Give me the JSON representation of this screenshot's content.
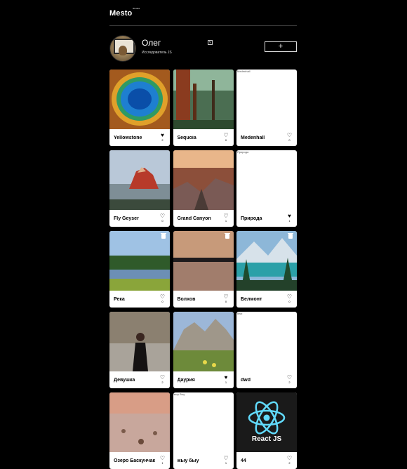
{
  "header": {
    "logo": "Mesto",
    "logo_sup": "Russia"
  },
  "profile": {
    "name": "Олег",
    "about": "Исследователь JS",
    "edit_icon": "✎",
    "add_icon": "+"
  },
  "cards": [
    {
      "title": "Yellowstone",
      "likes": "2",
      "liked": true,
      "trash": false,
      "alt": "",
      "image": "yellowstone"
    },
    {
      "title": "Sequoia",
      "likes": "0",
      "liked": false,
      "trash": false,
      "alt": "",
      "image": "sequoia"
    },
    {
      "title": "Medenhall",
      "likes": "0",
      "liked": false,
      "trash": false,
      "alt": "Medenhall",
      "image": "broken"
    },
    {
      "title": "Fly Geyser",
      "likes": "0",
      "liked": false,
      "trash": false,
      "alt": "",
      "image": "geyser"
    },
    {
      "title": "Grand Canyon",
      "likes": "1",
      "liked": false,
      "trash": false,
      "alt": "",
      "image": "canyon"
    },
    {
      "title": "Природа",
      "likes": "1",
      "liked": true,
      "trash": false,
      "alt": "Природа",
      "image": "broken"
    },
    {
      "title": "Река",
      "likes": "0",
      "liked": false,
      "trash": true,
      "alt": "",
      "image": "river"
    },
    {
      "title": "Волхов",
      "likes": "0",
      "liked": false,
      "trash": true,
      "alt": "",
      "image": "volkhov"
    },
    {
      "title": "Белмонт",
      "likes": "0",
      "liked": false,
      "trash": true,
      "alt": "",
      "image": "belmont"
    },
    {
      "title": "Девушка",
      "likes": "2",
      "liked": false,
      "trash": false,
      "alt": "",
      "image": "girl"
    },
    {
      "title": "Даурия",
      "likes": "1",
      "liked": true,
      "trash": false,
      "alt": "",
      "image": "dauria"
    },
    {
      "title": "dwd",
      "likes": "2",
      "liked": false,
      "trash": false,
      "alt": "dwd",
      "image": "broken"
    },
    {
      "title": "Озеро Баскунчак",
      "likes": "1",
      "liked": false,
      "trash": false,
      "alt": "",
      "image": "lake"
    },
    {
      "title": "жыу быу",
      "likes": "1",
      "liked": false,
      "trash": false,
      "alt": "жыу быу",
      "image": "broken"
    },
    {
      "title": "44",
      "likes": "2",
      "liked": false,
      "trash": false,
      "alt": "",
      "image": "react",
      "image_text": "React JS"
    }
  ]
}
